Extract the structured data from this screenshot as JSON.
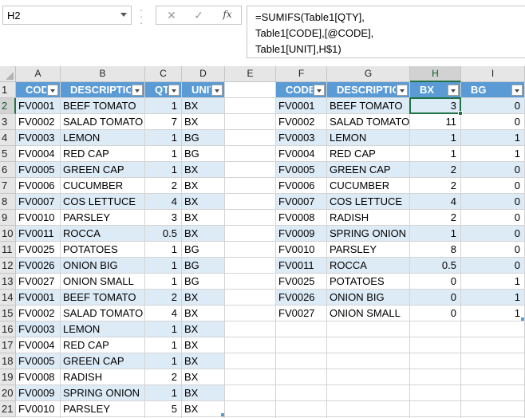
{
  "formula_bar": {
    "name_box": "H2",
    "cancel_icon": "x-icon",
    "enter_icon": "check-icon",
    "fx_label": "fx",
    "formula_lines": [
      "=SUMIFS(Table1[QTY],",
      "Table1[CODE],[@CODE],",
      "Table1[UNIT],H$1)"
    ]
  },
  "columns": [
    "A",
    "B",
    "C",
    "D",
    "E",
    "F",
    "G",
    "H",
    "I"
  ],
  "selected_column": "H",
  "selected_row": 2,
  "row_numbers": [
    1,
    2,
    3,
    4,
    5,
    6,
    7,
    8,
    9,
    10,
    11,
    12,
    13,
    14,
    15,
    16,
    17,
    18,
    19,
    20,
    21
  ],
  "table1": {
    "headers": [
      "CODE",
      "DESCRIPTION",
      "QTY",
      "UNIT"
    ],
    "rows": [
      [
        "FV0001",
        "BEEF TOMATO",
        "1",
        "BX"
      ],
      [
        "FV0002",
        "SALAD TOMATO",
        "7",
        "BX"
      ],
      [
        "FV0003",
        "LEMON",
        "1",
        "BG"
      ],
      [
        "FV0004",
        "RED CAP",
        "1",
        "BG"
      ],
      [
        "FV0005",
        "GREEN CAP",
        "1",
        "BX"
      ],
      [
        "FV0006",
        "CUCUMBER",
        "2",
        "BX"
      ],
      [
        "FV0007",
        "COS LETTUCE",
        "4",
        "BX"
      ],
      [
        "FV0010",
        "PARSLEY",
        "3",
        "BX"
      ],
      [
        "FV0011",
        "ROCCA",
        "0.5",
        "BX"
      ],
      [
        "FV0025",
        "POTATOES",
        "1",
        "BG"
      ],
      [
        "FV0026",
        "ONION BIG",
        "1",
        "BG"
      ],
      [
        "FV0027",
        "ONION SMALL",
        "1",
        "BG"
      ],
      [
        "FV0001",
        "BEEF TOMATO",
        "2",
        "BX"
      ],
      [
        "FV0002",
        "SALAD TOMATO",
        "4",
        "BX"
      ],
      [
        "FV0003",
        "LEMON",
        "1",
        "BX"
      ],
      [
        "FV0004",
        "RED CAP",
        "1",
        "BX"
      ],
      [
        "FV0005",
        "GREEN CAP",
        "1",
        "BX"
      ],
      [
        "FV0008",
        "RADISH",
        "2",
        "BX"
      ],
      [
        "FV0009",
        "SPRING ONION",
        "1",
        "BX"
      ],
      [
        "FV0010",
        "PARSLEY",
        "5",
        "BX"
      ]
    ]
  },
  "table2": {
    "headers": [
      "CODE",
      "DESCRIPTION",
      "BX",
      "BG"
    ],
    "rows": [
      [
        "FV0001",
        "BEEF TOMATO",
        "3",
        "0"
      ],
      [
        "FV0002",
        "SALAD TOMATO",
        "11",
        "0"
      ],
      [
        "FV0003",
        "LEMON",
        "1",
        "1"
      ],
      [
        "FV0004",
        "RED CAP",
        "1",
        "1"
      ],
      [
        "FV0005",
        "GREEN CAP",
        "2",
        "0"
      ],
      [
        "FV0006",
        "CUCUMBER",
        "2",
        "0"
      ],
      [
        "FV0007",
        "COS LETTUCE",
        "4",
        "0"
      ],
      [
        "FV0008",
        "RADISH",
        "2",
        "0"
      ],
      [
        "FV0009",
        "SPRING ONION",
        "1",
        "0"
      ],
      [
        "FV0010",
        "PARSLEY",
        "8",
        "0"
      ],
      [
        "FV0011",
        "ROCCA",
        "0.5",
        "0"
      ],
      [
        "FV0025",
        "POTATOES",
        "0",
        "1"
      ],
      [
        "FV0026",
        "ONION BIG",
        "0",
        "1"
      ],
      [
        "FV0027",
        "ONION SMALL",
        "0",
        "1"
      ]
    ]
  },
  "colors": {
    "header_fill": "#5b9bd5",
    "band_fill": "#ddebf7",
    "selection": "#217346"
  }
}
